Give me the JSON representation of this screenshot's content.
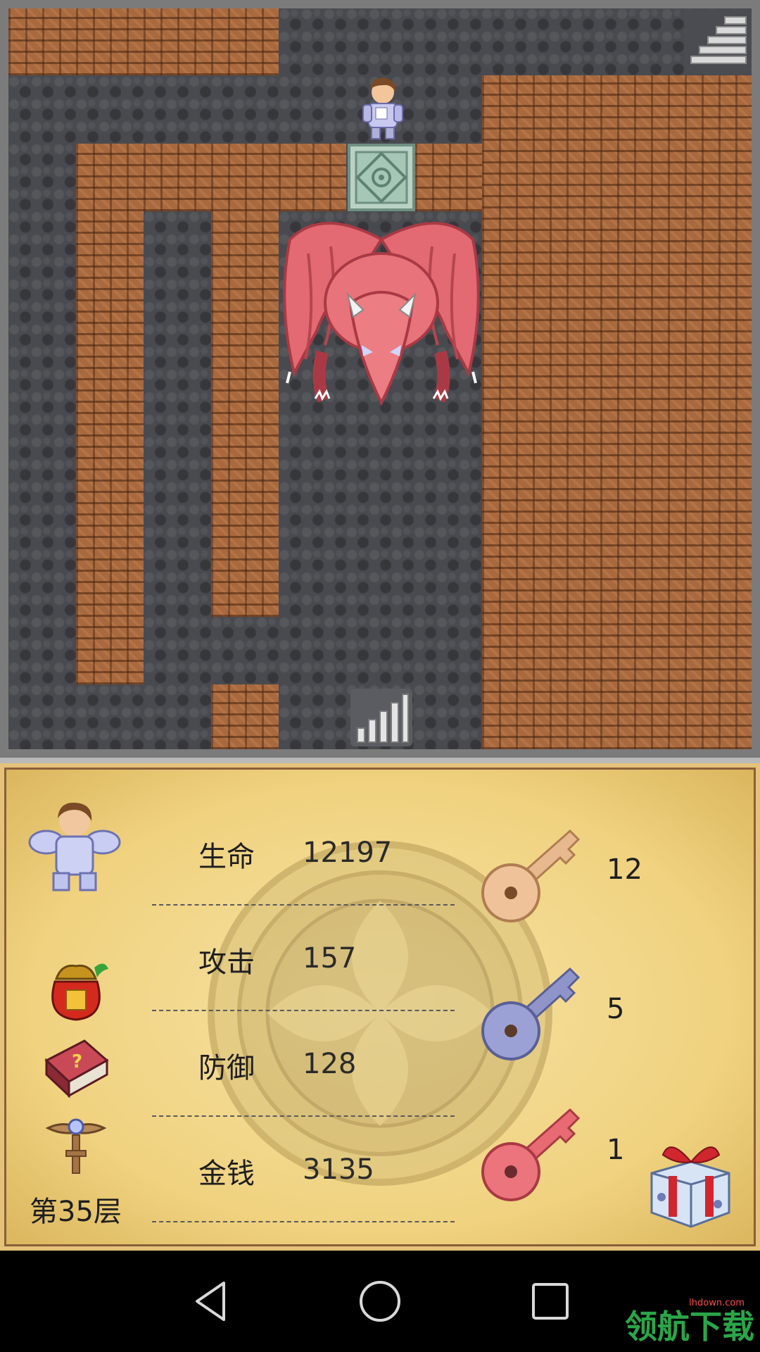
{
  "stats": [
    {
      "label": "生命",
      "value": "12197"
    },
    {
      "label": "攻击",
      "value": "157"
    },
    {
      "label": "防御",
      "value": "128"
    },
    {
      "label": "金钱",
      "value": "3135"
    }
  ],
  "keys": {
    "yellow": "12",
    "blue": "5",
    "red": "1"
  },
  "floor_label": "第35层",
  "watermark": {
    "text": "领航下载",
    "sub": "lhdown.com"
  },
  "colors": {
    "panel_bg": "#f3d88a",
    "wall": "#a8693e",
    "floor": "#494a4f",
    "dragon": "#e0616a",
    "yellow_key": "#e8b98e",
    "blue_key": "#8f95c9",
    "red_key": "#e86a72"
  },
  "icons": {
    "hero": "hero-sprite",
    "item_bag": "lucky-bag-icon",
    "monster_book": "monster-manual-icon",
    "fly_wand": "floor-fly-icon",
    "gift": "gift-box-icon",
    "stairs_up": "stairs-up-icon",
    "stairs_down": "stairs-down-icon",
    "door": "iron-door-icon",
    "monster": "red-dragon-sprite"
  }
}
